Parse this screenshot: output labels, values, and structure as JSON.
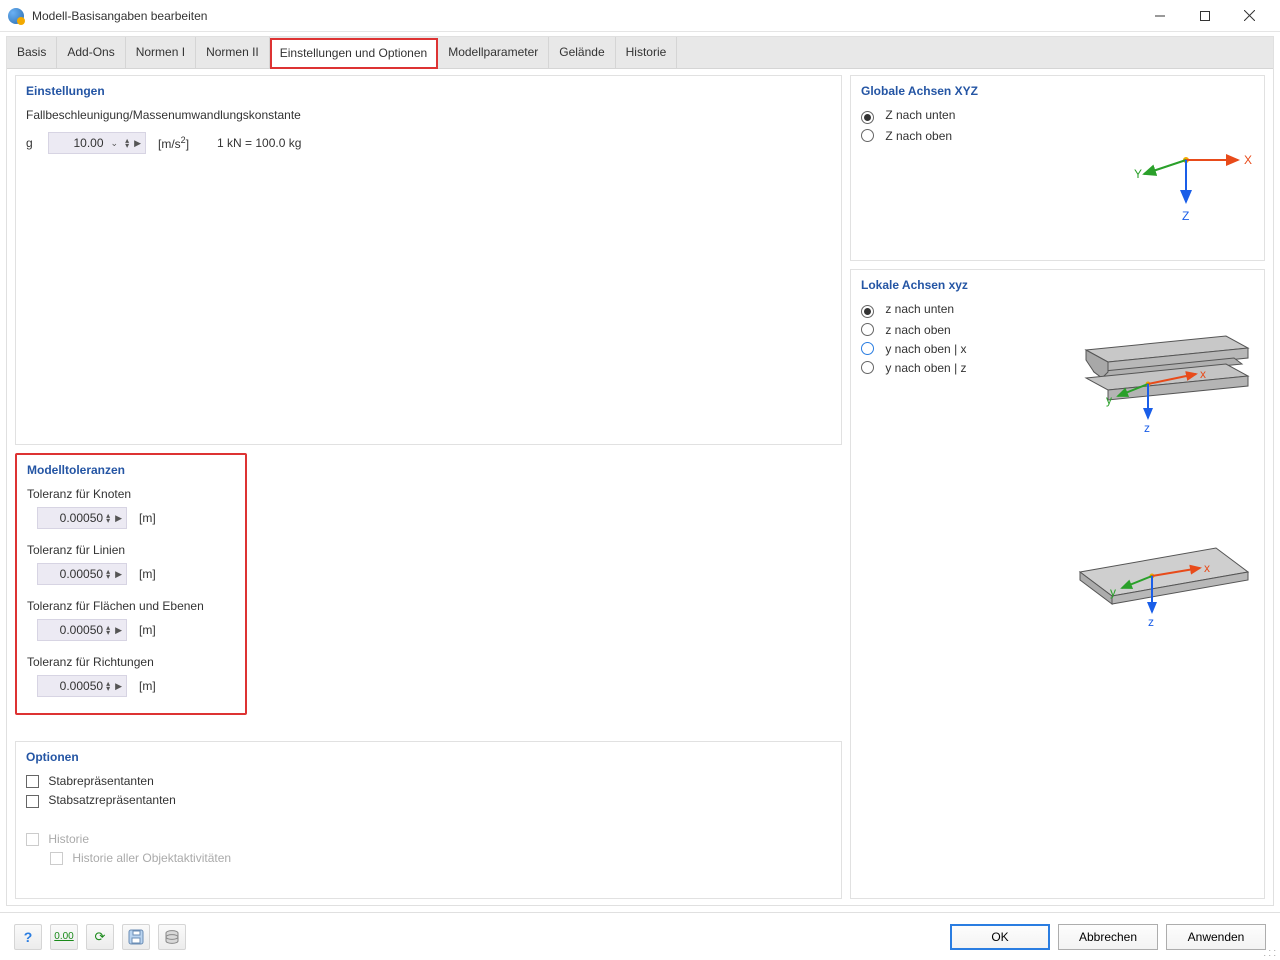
{
  "window": {
    "title": "Modell-Basisangaben bearbeiten"
  },
  "tabs": [
    "Basis",
    "Add-Ons",
    "Normen I",
    "Normen II",
    "Einstellungen und Optionen",
    "Modellparameter",
    "Gelände",
    "Historie"
  ],
  "active_tab_index": 4,
  "settings": {
    "title": "Einstellungen",
    "gravity_label": "Fallbeschleunigung/Massenumwandlungskonstante",
    "g_symbol": "g",
    "g_value": "10.00",
    "g_unit": "[m/s²]",
    "kn_hint": "1 kN = 100.0 kg"
  },
  "tolerances": {
    "title": "Modelltoleranzen",
    "items": [
      {
        "label": "Toleranz für Knoten",
        "value": "0.00050",
        "unit": "[m]"
      },
      {
        "label": "Toleranz für Linien",
        "value": "0.00050",
        "unit": "[m]"
      },
      {
        "label": "Toleranz für Flächen und Ebenen",
        "value": "0.00050",
        "unit": "[m]"
      },
      {
        "label": "Toleranz für Richtungen",
        "value": "0.00050",
        "unit": "[m]"
      }
    ]
  },
  "options": {
    "title": "Optionen",
    "items": [
      {
        "label": "Stabrepräsentanten",
        "checked": false,
        "disabled": false
      },
      {
        "label": "Stabsatzrepräsentanten",
        "checked": false,
        "disabled": false
      },
      {
        "label": "Historie",
        "checked": false,
        "disabled": true
      },
      {
        "label": "Historie aller Objektaktivitäten",
        "checked": false,
        "disabled": true,
        "indent": true
      }
    ]
  },
  "global_axes": {
    "title": "Globale Achsen XYZ",
    "options": [
      {
        "label": "Z nach unten",
        "checked": true
      },
      {
        "label": "Z nach oben",
        "checked": false
      }
    ],
    "labels": {
      "x": "X",
      "y": "Y",
      "z": "Z"
    }
  },
  "local_axes": {
    "title": "Lokale Achsen xyz",
    "options": [
      {
        "label": "z nach unten",
        "checked": true
      },
      {
        "label": "z nach oben",
        "checked": false
      },
      {
        "label": "y nach oben | x",
        "checked": false,
        "hover": true
      },
      {
        "label": "y nach oben | z",
        "checked": false
      }
    ],
    "labels": {
      "x": "x",
      "y": "y",
      "z": "z"
    }
  },
  "footer": {
    "ok": "OK",
    "cancel": "Abbrechen",
    "apply": "Anwenden"
  }
}
